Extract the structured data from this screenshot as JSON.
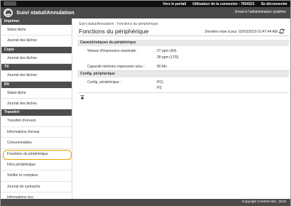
{
  "topbar": {
    "portal_link": "Vers le portail",
    "login_user": "Utilisateur de la connexion : 7654321",
    "logout": "Se déconnecter"
  },
  "header": {
    "title": "Suivi statut/Annulation",
    "admin_mail": "Email à l'administrateur système"
  },
  "sidebar": {
    "groups": [
      {
        "title": "Imprimer",
        "items": [
          "Statut tâche",
          "Journal des tâches"
        ]
      },
      {
        "title": "Copie",
        "items": [
          "Journal des tâches"
        ]
      },
      {
        "title": "TX",
        "items": [
          "Journal des tâches"
        ]
      },
      {
        "title": "RX",
        "items": [
          "Statut tâche",
          "Journal des tâches"
        ]
      },
      {
        "title": "Transfert",
        "items": [
          "Transfert d'erreurs",
          "Informations d'erreur",
          "Consommables",
          "Fonctions du périphérique",
          "Infos périphérique",
          "Vérifier le compteur",
          "Journal de cartouche",
          "Informations éco"
        ]
      }
    ],
    "active_item": "Fonctions du périphérique"
  },
  "main": {
    "breadcrumb": "Suivi statut/Annulation : Fonctions du périphérique",
    "title": "Fonctions du périphérique",
    "last_updated": "Dernière mise à jour :02/03/2019 01:47:44 AM",
    "sections": [
      {
        "title": "Caractéristiques du périphérique",
        "rows": [
          {
            "label": "Vitesse d'impression maximale :",
            "values": [
              "27 ppm (A4)",
              "28 ppm (LTR)"
            ]
          },
          {
            "label": "Capacité mémoire impression sécu :",
            "values": [
              "80 Mo"
            ]
          }
        ]
      },
      {
        "title": "Config. périphérique",
        "rows": [
          {
            "label": "Config. périphérique :",
            "values": [
              "PCL",
              "PS"
            ]
          }
        ]
      }
    ]
  },
  "footer": {
    "copyright": "Copyright CANON INC. 2018"
  },
  "colors": {
    "topbar": "#111111",
    "header": "#4a4a4a",
    "sidebar_heading": "#4d4d4d",
    "highlight": "#f2a100"
  }
}
